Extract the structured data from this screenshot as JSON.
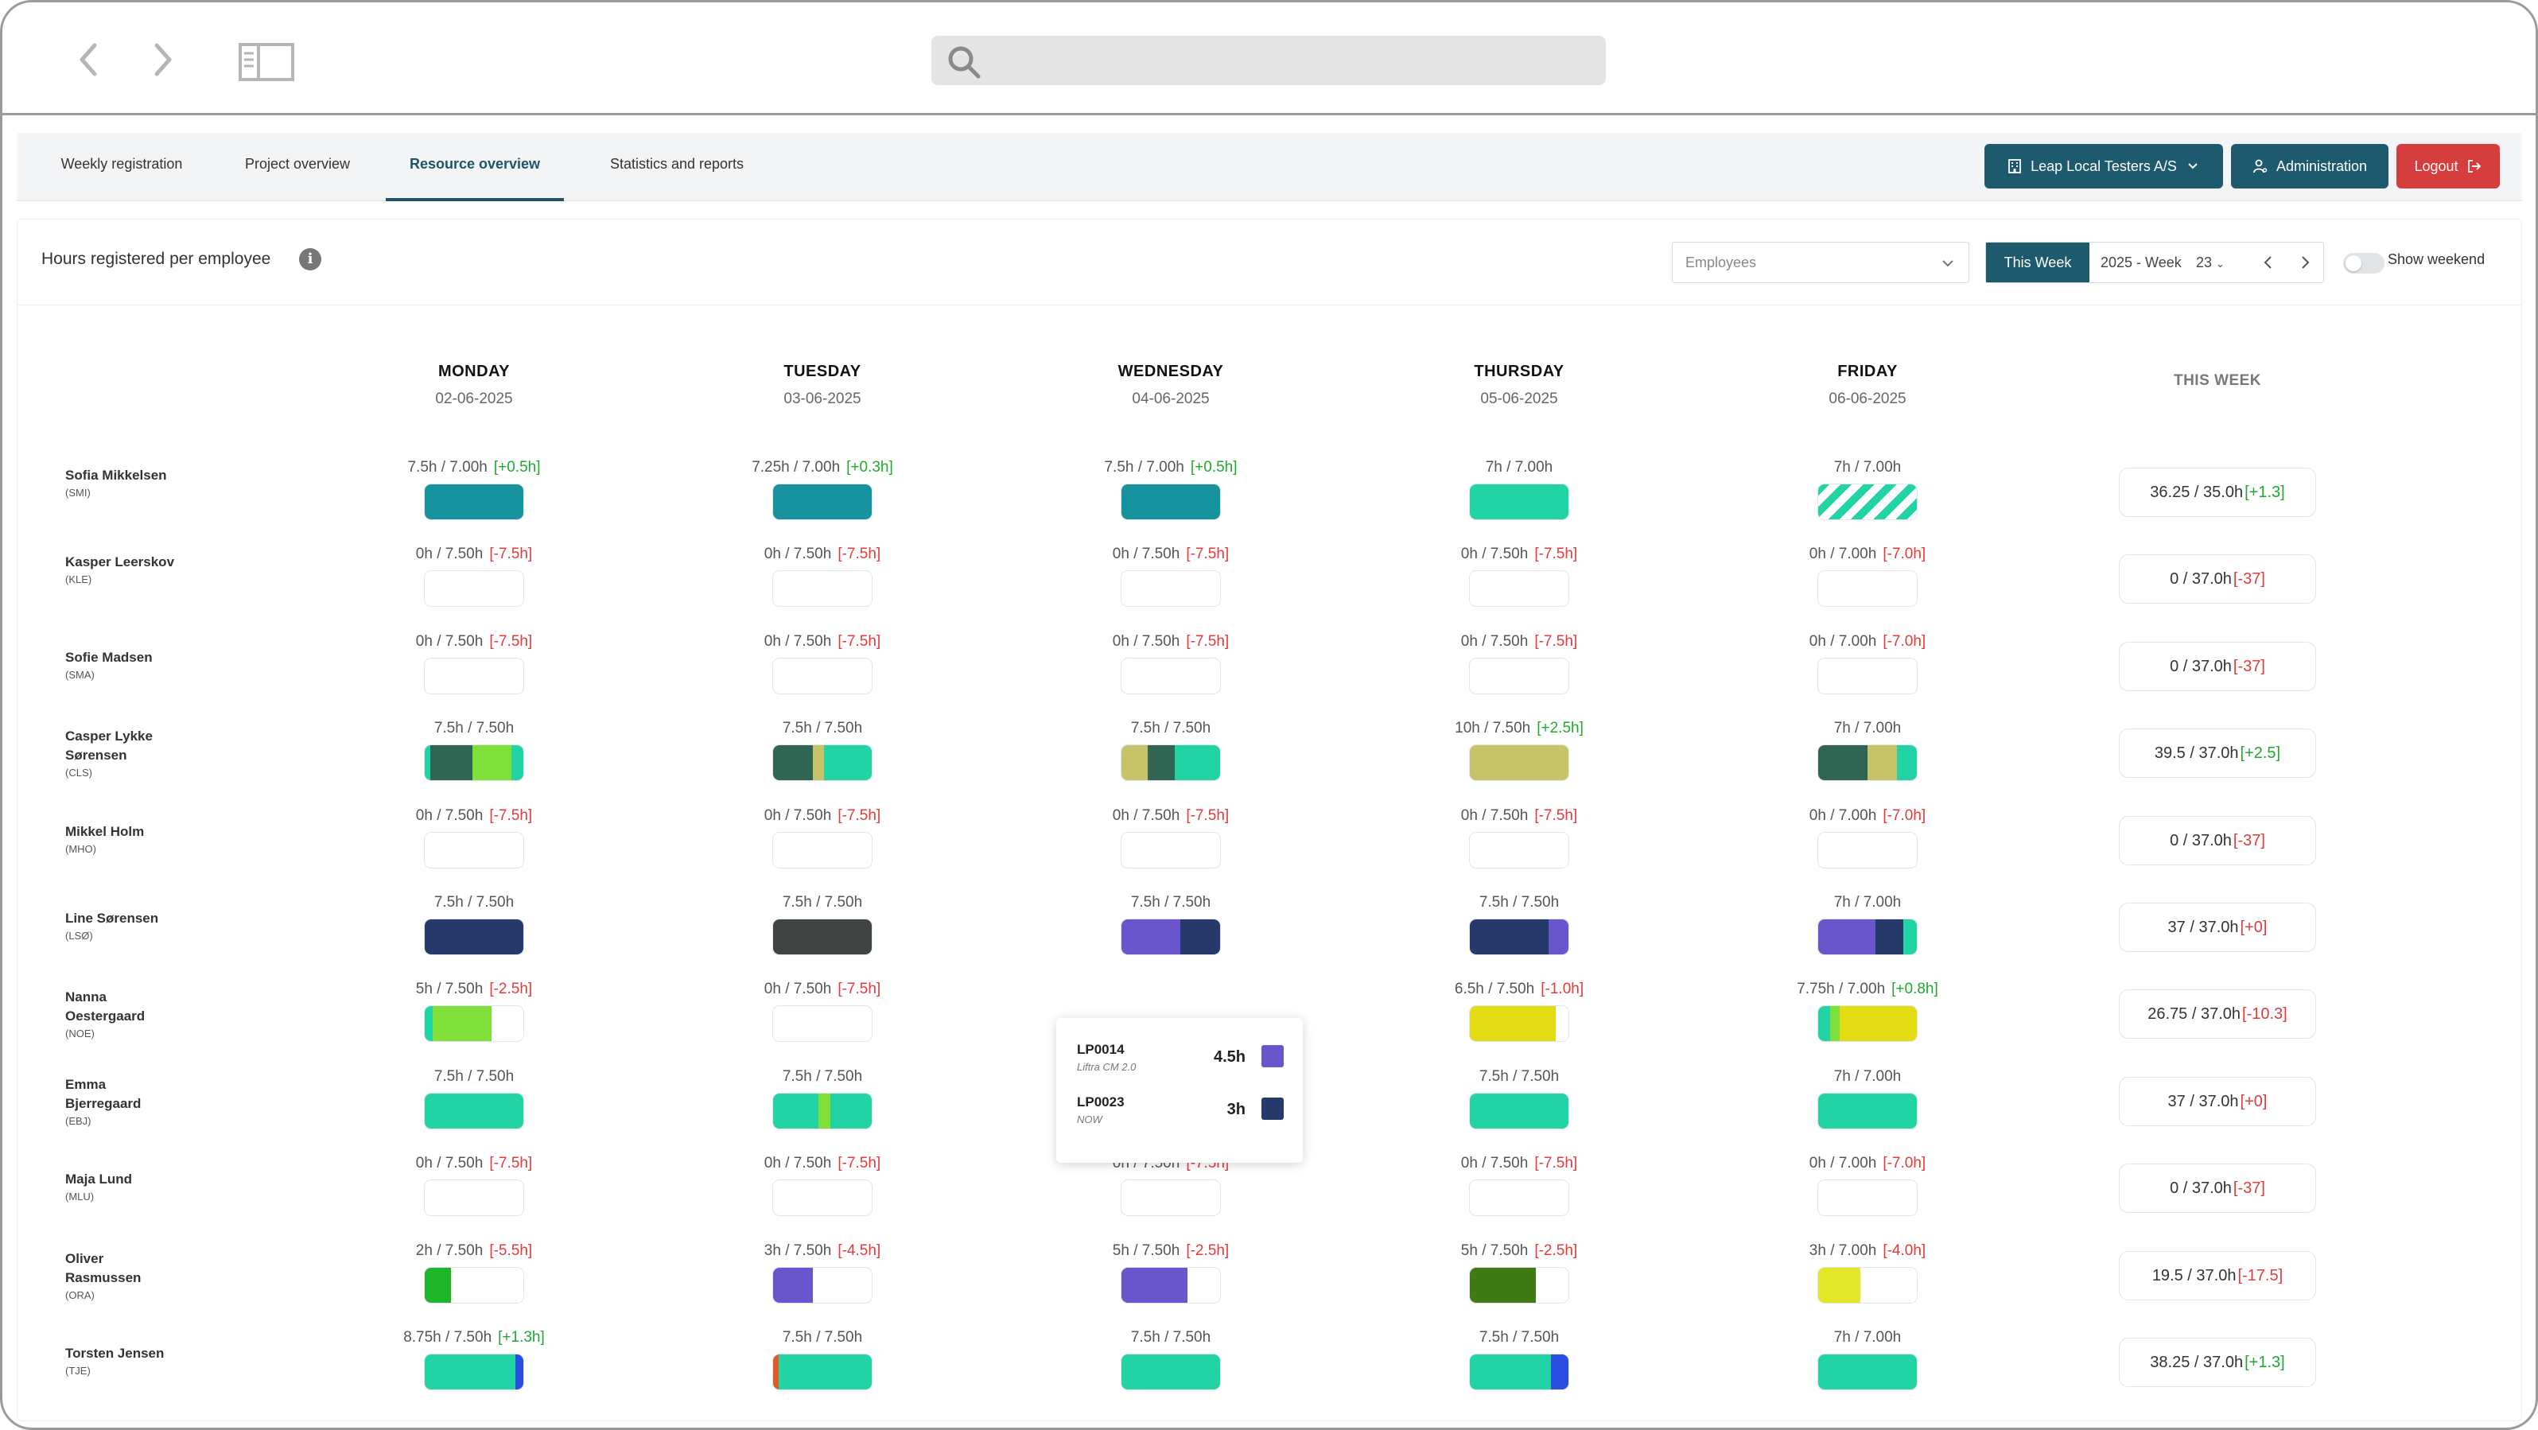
{
  "nav": {
    "tabs": [
      "Weekly registration",
      "Project overview",
      "Resource overview",
      "Statistics and reports"
    ],
    "company_label": "Leap Local Testers A/S",
    "admin_label": "Administration",
    "logout_label": "Logout"
  },
  "panel": {
    "title": "Hours registered per employee",
    "info_glyph": "i",
    "employees_placeholder": "Employees",
    "this_week_label": "This Week",
    "week_label": "2025 - Week",
    "week_number": "23",
    "show_weekend_label": "Show weekend"
  },
  "days": [
    {
      "name": "MONDAY",
      "date": "02-06-2025"
    },
    {
      "name": "TUESDAY",
      "date": "03-06-2025"
    },
    {
      "name": "WEDNESDAY",
      "date": "04-06-2025"
    },
    {
      "name": "THURSDAY",
      "date": "05-06-2025"
    },
    {
      "name": "FRIDAY",
      "date": "06-06-2025"
    }
  ],
  "week_header": "THIS WEEK",
  "colors": {
    "teal_dark": "#17929f",
    "mint": "#22d3a6",
    "forest": "#2f6552",
    "lime": "#7fe03a",
    "olive": "#c7c36a",
    "navy": "#253a6b",
    "charcoal": "#3f4442",
    "purple": "#6a56cc",
    "yellow": "#e4dc12",
    "green": "#1eb52a",
    "darkgreen": "#3f7a12",
    "blue": "#2a4fe0",
    "orange": "#e05a2a",
    "brand": "#1e5a6d",
    "logout": "#d63d3d"
  },
  "employees": [
    {
      "name": "Sofia Mikkelsen",
      "code": "(SMI)",
      "days": [
        {
          "text": "7.5h / 7.00h",
          "delta": "[+0.5h]",
          "sign": "pos",
          "segments": [
            {
              "color": "#17929f",
              "frac": 1
            }
          ]
        },
        {
          "text": "7.25h / 7.00h",
          "delta": "[+0.3h]",
          "sign": "pos",
          "segments": [
            {
              "color": "#17929f",
              "frac": 1
            }
          ]
        },
        {
          "text": "7.5h / 7.00h",
          "delta": "[+0.5h]",
          "sign": "pos",
          "segments": [
            {
              "color": "#17929f",
              "frac": 1
            }
          ]
        },
        {
          "text": "7h / 7.00h",
          "delta": "",
          "sign": "",
          "segments": [
            {
              "color": "#22d3a6",
              "frac": 1
            }
          ]
        },
        {
          "text": "7h / 7.00h",
          "delta": "",
          "sign": "",
          "hatch": true,
          "segments": []
        }
      ],
      "total": {
        "text": "36.25 / 35.0h",
        "delta": "[+1.3]",
        "sign": "pos"
      }
    },
    {
      "name": "Kasper Leerskov",
      "code": "(KLE)",
      "days": [
        {
          "text": "0h / 7.50h",
          "delta": "[-7.5h]",
          "sign": "neg",
          "segments": []
        },
        {
          "text": "0h / 7.50h",
          "delta": "[-7.5h]",
          "sign": "neg",
          "segments": []
        },
        {
          "text": "0h / 7.50h",
          "delta": "[-7.5h]",
          "sign": "neg",
          "segments": []
        },
        {
          "text": "0h / 7.50h",
          "delta": "[-7.5h]",
          "sign": "neg",
          "segments": []
        },
        {
          "text": "0h / 7.00h",
          "delta": "[-7.0h]",
          "sign": "neg",
          "segments": []
        }
      ],
      "total": {
        "text": "0 / 37.0h",
        "delta": "[-37]",
        "sign": "neg"
      }
    },
    {
      "name": "Sofie Madsen",
      "code": "(SMA)",
      "days": [
        {
          "text": "0h / 7.50h",
          "delta": "[-7.5h]",
          "sign": "neg",
          "segments": []
        },
        {
          "text": "0h / 7.50h",
          "delta": "[-7.5h]",
          "sign": "neg",
          "segments": []
        },
        {
          "text": "0h / 7.50h",
          "delta": "[-7.5h]",
          "sign": "neg",
          "segments": []
        },
        {
          "text": "0h / 7.50h",
          "delta": "[-7.5h]",
          "sign": "neg",
          "segments": []
        },
        {
          "text": "0h / 7.00h",
          "delta": "[-7.0h]",
          "sign": "neg",
          "segments": []
        }
      ],
      "total": {
        "text": "0 / 37.0h",
        "delta": "[-37]",
        "sign": "neg"
      }
    },
    {
      "name": "Casper Lykke Sørensen",
      "code": "(CLS)",
      "days": [
        {
          "text": "7.5h / 7.50h",
          "delta": "",
          "sign": "",
          "segments": [
            {
              "color": "#22d3a6",
              "frac": 0.06
            },
            {
              "color": "#2f6552",
              "frac": 0.42
            },
            {
              "color": "#7fe03a",
              "frac": 0.4
            },
            {
              "color": "#22d3a6",
              "frac": 0.12
            }
          ]
        },
        {
          "text": "7.5h / 7.50h",
          "delta": "",
          "sign": "",
          "segments": [
            {
              "color": "#2f6552",
              "frac": 0.4
            },
            {
              "color": "#c7c36a",
              "frac": 0.12
            },
            {
              "color": "#22d3a6",
              "frac": 0.48
            }
          ]
        },
        {
          "text": "7.5h / 7.50h",
          "delta": "",
          "sign": "",
          "segments": [
            {
              "color": "#c7c36a",
              "frac": 0.27
            },
            {
              "color": "#2f6552",
              "frac": 0.27
            },
            {
              "color": "#22d3a6",
              "frac": 0.46
            }
          ]
        },
        {
          "text": "10h / 7.50h",
          "delta": "[+2.5h]",
          "sign": "pos",
          "segments": [
            {
              "color": "#c7c36a",
              "frac": 1
            }
          ]
        },
        {
          "text": "7h / 7.00h",
          "delta": "",
          "sign": "",
          "segments": [
            {
              "color": "#2f6552",
              "frac": 0.5
            },
            {
              "color": "#c7c36a",
              "frac": 0.3
            },
            {
              "color": "#22d3a6",
              "frac": 0.2
            }
          ]
        }
      ],
      "total": {
        "text": "39.5 / 37.0h",
        "delta": "[+2.5]",
        "sign": "pos"
      }
    },
    {
      "name": "Mikkel Holm",
      "code": "(MHO)",
      "days": [
        {
          "text": "0h / 7.50h",
          "delta": "[-7.5h]",
          "sign": "neg",
          "segments": []
        },
        {
          "text": "0h / 7.50h",
          "delta": "[-7.5h]",
          "sign": "neg",
          "segments": []
        },
        {
          "text": "0h / 7.50h",
          "delta": "[-7.5h]",
          "sign": "neg",
          "segments": []
        },
        {
          "text": "0h / 7.50h",
          "delta": "[-7.5h]",
          "sign": "neg",
          "segments": []
        },
        {
          "text": "0h / 7.00h",
          "delta": "[-7.0h]",
          "sign": "neg",
          "segments": []
        }
      ],
      "total": {
        "text": "0 / 37.0h",
        "delta": "[-37]",
        "sign": "neg"
      }
    },
    {
      "name": "Line Sørensen",
      "code": "(LSØ)",
      "days": [
        {
          "text": "7.5h / 7.50h",
          "delta": "",
          "sign": "",
          "segments": [
            {
              "color": "#253a6b",
              "frac": 1
            }
          ]
        },
        {
          "text": "7.5h / 7.50h",
          "delta": "",
          "sign": "",
          "segments": [
            {
              "color": "#3f4442",
              "frac": 1
            }
          ]
        },
        {
          "text": "7.5h / 7.50h",
          "delta": "",
          "sign": "",
          "segments": [
            {
              "color": "#6a56cc",
              "frac": 0.6
            },
            {
              "color": "#253a6b",
              "frac": 0.4
            }
          ]
        },
        {
          "text": "7.5h / 7.50h",
          "delta": "",
          "sign": "",
          "segments": [
            {
              "color": "#253a6b",
              "frac": 0.8
            },
            {
              "color": "#6a56cc",
              "frac": 0.2
            }
          ]
        },
        {
          "text": "7h / 7.00h",
          "delta": "",
          "sign": "",
          "segments": [
            {
              "color": "#6a56cc",
              "frac": 0.58
            },
            {
              "color": "#253a6b",
              "frac": 0.28
            },
            {
              "color": "#22d3a6",
              "frac": 0.14
            }
          ]
        }
      ],
      "total": {
        "text": "37 / 37.0h",
        "delta": "[+0]",
        "sign": "neg"
      }
    },
    {
      "name": "Nanna Oestergaard",
      "code": "(NOE)",
      "days": [
        {
          "text": "5h / 7.50h",
          "delta": "[-2.5h]",
          "sign": "neg",
          "segments": [
            {
              "color": "#22d3a6",
              "frac": 0.08
            },
            {
              "color": "#7fe03a",
              "frac": 0.6
            }
          ]
        },
        {
          "text": "0h / 7.50h",
          "delta": "[-7.5h]",
          "sign": "neg",
          "segments": []
        },
        {
          "text": "",
          "delta": "",
          "sign": "",
          "hidden": true,
          "segments": []
        },
        {
          "text": "6.5h / 7.50h",
          "delta": "[-1.0h]",
          "sign": "neg",
          "segments": [
            {
              "color": "#e4dc12",
              "frac": 0.87
            }
          ]
        },
        {
          "text": "7.75h / 7.00h",
          "delta": "[+0.8h]",
          "sign": "pos",
          "segments": [
            {
              "color": "#22d3a6",
              "frac": 0.12
            },
            {
              "color": "#7fe03a",
              "frac": 0.1
            },
            {
              "color": "#e4dc12",
              "frac": 0.78
            }
          ]
        }
      ],
      "total": {
        "text": "26.75 / 37.0h",
        "delta": "[-10.3]",
        "sign": "neg"
      }
    },
    {
      "name": "Emma Bjerregaard",
      "code": "(EBJ)",
      "days": [
        {
          "text": "7.5h / 7.50h",
          "delta": "",
          "sign": "",
          "segments": [
            {
              "color": "#22d3a6",
              "frac": 1
            }
          ]
        },
        {
          "text": "7.5h / 7.50h",
          "delta": "",
          "sign": "",
          "segments": [
            {
              "color": "#22d3a6",
              "frac": 0.46
            },
            {
              "color": "#7fe03a",
              "frac": 0.12
            },
            {
              "color": "#22d3a6",
              "frac": 0.42
            }
          ]
        },
        {
          "text": "",
          "delta": "",
          "sign": "",
          "hidden": true,
          "segments": []
        },
        {
          "text": "7.5h / 7.50h",
          "delta": "",
          "sign": "",
          "segments": [
            {
              "color": "#22d3a6",
              "frac": 1
            }
          ]
        },
        {
          "text": "7h / 7.00h",
          "delta": "",
          "sign": "",
          "segments": [
            {
              "color": "#22d3a6",
              "frac": 1
            }
          ]
        }
      ],
      "total": {
        "text": "37 / 37.0h",
        "delta": "[+0]",
        "sign": "neg"
      }
    },
    {
      "name": "Maja Lund",
      "code": "(MLU)",
      "days": [
        {
          "text": "0h / 7.50h",
          "delta": "[-7.5h]",
          "sign": "neg",
          "segments": []
        },
        {
          "text": "0h / 7.50h",
          "delta": "[-7.5h]",
          "sign": "neg",
          "segments": []
        },
        {
          "text": "0h / 7.50h",
          "delta": "[-7.5h]",
          "sign": "neg",
          "segments": []
        },
        {
          "text": "0h / 7.50h",
          "delta": "[-7.5h]",
          "sign": "neg",
          "segments": []
        },
        {
          "text": "0h / 7.00h",
          "delta": "[-7.0h]",
          "sign": "neg",
          "segments": []
        }
      ],
      "total": {
        "text": "0 / 37.0h",
        "delta": "[-37]",
        "sign": "neg"
      }
    },
    {
      "name": "Oliver Rasmussen",
      "code": "(ORA)",
      "days": [
        {
          "text": "2h / 7.50h",
          "delta": "[-5.5h]",
          "sign": "neg",
          "segments": [
            {
              "color": "#1eb52a",
              "frac": 0.27
            }
          ]
        },
        {
          "text": "3h / 7.50h",
          "delta": "[-4.5h]",
          "sign": "neg",
          "segments": [
            {
              "color": "#6a56cc",
              "frac": 0.4
            }
          ]
        },
        {
          "text": "5h / 7.50h",
          "delta": "[-2.5h]",
          "sign": "neg",
          "segments": [
            {
              "color": "#6a56cc",
              "frac": 0.67
            }
          ]
        },
        {
          "text": "5h / 7.50h",
          "delta": "[-2.5h]",
          "sign": "neg",
          "segments": [
            {
              "color": "#3f7a12",
              "frac": 0.67
            }
          ]
        },
        {
          "text": "3h / 7.00h",
          "delta": "[-4.0h]",
          "sign": "neg",
          "segments": [
            {
              "color": "#e4e62a",
              "frac": 0.43
            }
          ]
        }
      ],
      "total": {
        "text": "19.5 / 37.0h",
        "delta": "[-17.5]",
        "sign": "neg"
      }
    },
    {
      "name": "Torsten Jensen",
      "code": "(TJE)",
      "days": [
        {
          "text": "8.75h / 7.50h",
          "delta": "[+1.3h]",
          "sign": "pos",
          "segments": [
            {
              "color": "#22d3a6",
              "frac": 0.92
            },
            {
              "color": "#2a4fe0",
              "frac": 0.08
            }
          ]
        },
        {
          "text": "7.5h / 7.50h",
          "delta": "",
          "sign": "",
          "segments": [
            {
              "color": "#e05a2a",
              "frac": 0.06
            },
            {
              "color": "#22d3a6",
              "frac": 0.94
            }
          ]
        },
        {
          "text": "7.5h / 7.50h",
          "delta": "",
          "sign": "",
          "segments": [
            {
              "color": "#22d3a6",
              "frac": 1
            }
          ]
        },
        {
          "text": "7.5h / 7.50h",
          "delta": "",
          "sign": "",
          "segments": [
            {
              "color": "#22d3a6",
              "frac": 0.82
            },
            {
              "color": "#2a4fe0",
              "frac": 0.18
            }
          ]
        },
        {
          "text": "7h / 7.00h",
          "delta": "",
          "sign": "",
          "segments": [
            {
              "color": "#22d3a6",
              "frac": 1
            }
          ]
        }
      ],
      "total": {
        "text": "38.25 / 37.0h",
        "delta": "[+1.3]",
        "sign": "pos"
      }
    }
  ],
  "tooltip": {
    "items": [
      {
        "code": "LP0014",
        "project": "Liftra CM 2.0",
        "hours": "4.5h",
        "color": "#6a56cc"
      },
      {
        "code": "LP0023",
        "project": "NOW",
        "hours": "3h",
        "color": "#253a6b"
      }
    ]
  }
}
